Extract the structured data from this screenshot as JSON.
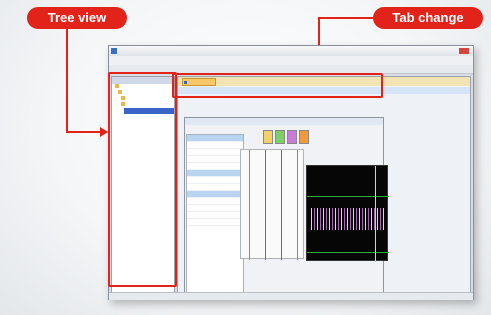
{
  "callouts": {
    "tree_view": "Tree view",
    "tab_change": "Tab change"
  },
  "colors": {
    "callout_red": "#e2231a",
    "scope_background": "#050605"
  },
  "window": {
    "icons": {
      "tree_view": "folder-tree-icon",
      "tab": "document-tab-icon"
    }
  }
}
